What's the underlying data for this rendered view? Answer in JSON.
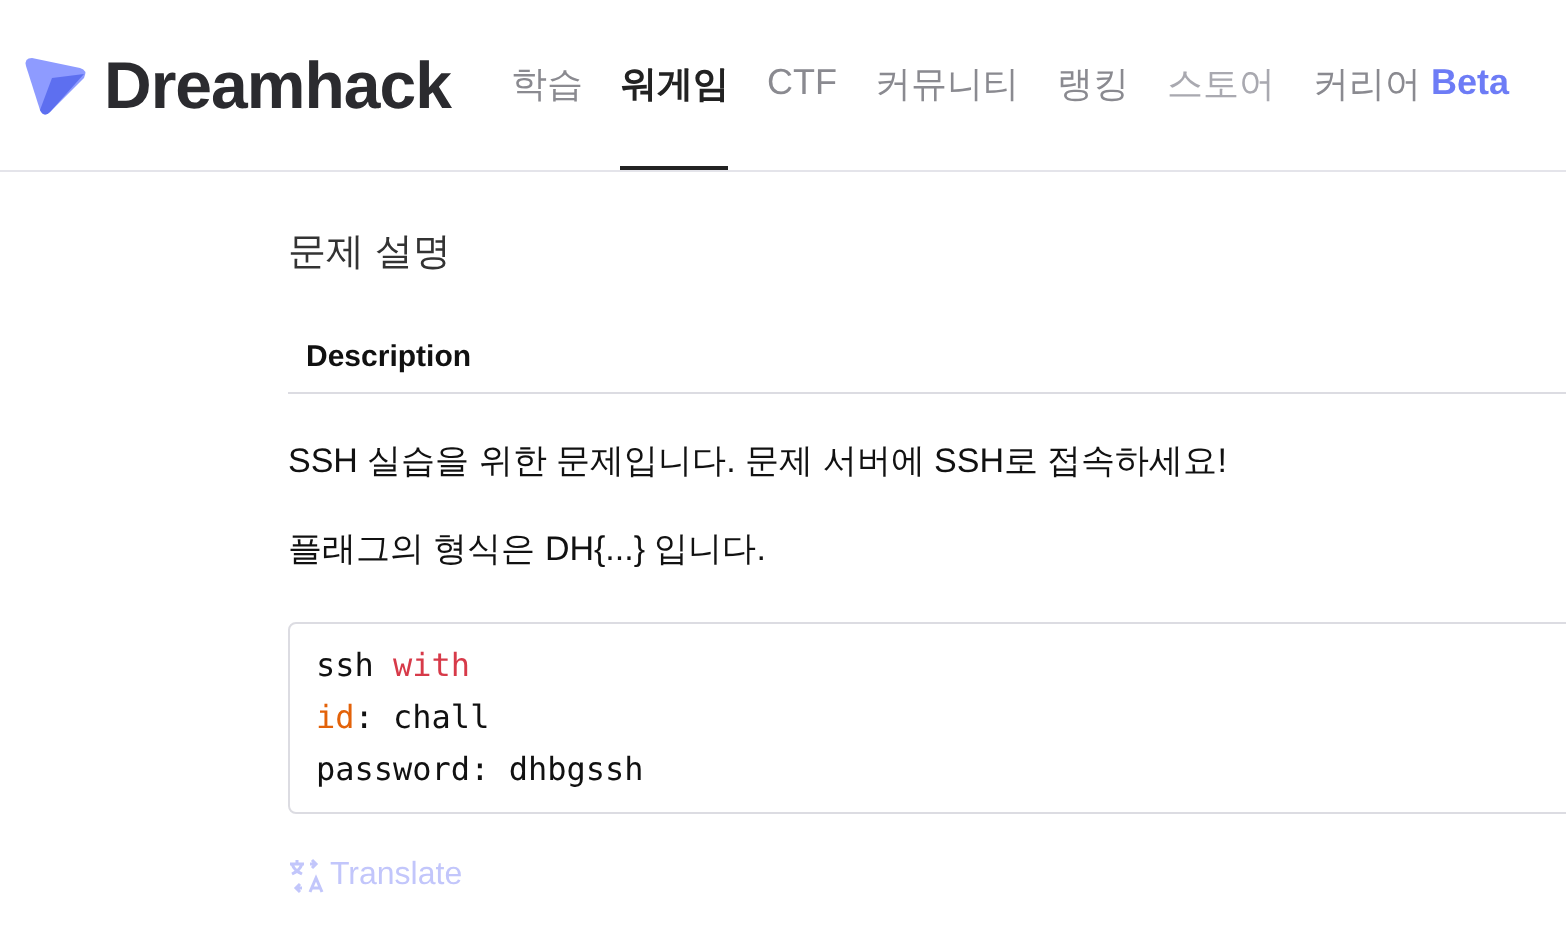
{
  "header": {
    "logo": "Dreamhack",
    "nav": [
      {
        "label": "학습",
        "selected": false,
        "disabled": false
      },
      {
        "label": "워게임",
        "selected": true,
        "disabled": false
      },
      {
        "label": "CTF",
        "selected": false,
        "disabled": false
      },
      {
        "label": "커뮤니티",
        "selected": false,
        "disabled": false
      },
      {
        "label": "랭킹",
        "selected": false,
        "disabled": false
      },
      {
        "label": "스토어",
        "selected": false,
        "disabled": true
      },
      {
        "label": "커리어",
        "selected": false,
        "disabled": false,
        "badge": "Beta"
      }
    ]
  },
  "section": {
    "title": "문제 설명",
    "tab": "Description",
    "paragraphs": [
      "SSH 실습을 위한 문제입니다. 문제 서버에 SSH로 접속하세요!",
      "플래그의 형식은 DH{...} 입니다."
    ],
    "code": [
      [
        {
          "text": "ssh ",
          "kind": "plain"
        },
        {
          "text": "with",
          "kind": "keyword"
        }
      ],
      [
        {
          "text": "id",
          "kind": "attr"
        },
        {
          "text": ": chall",
          "kind": "plain"
        }
      ],
      [
        {
          "text": "password: dhbgssh",
          "kind": "plain"
        }
      ]
    ],
    "translate": "Translate"
  }
}
